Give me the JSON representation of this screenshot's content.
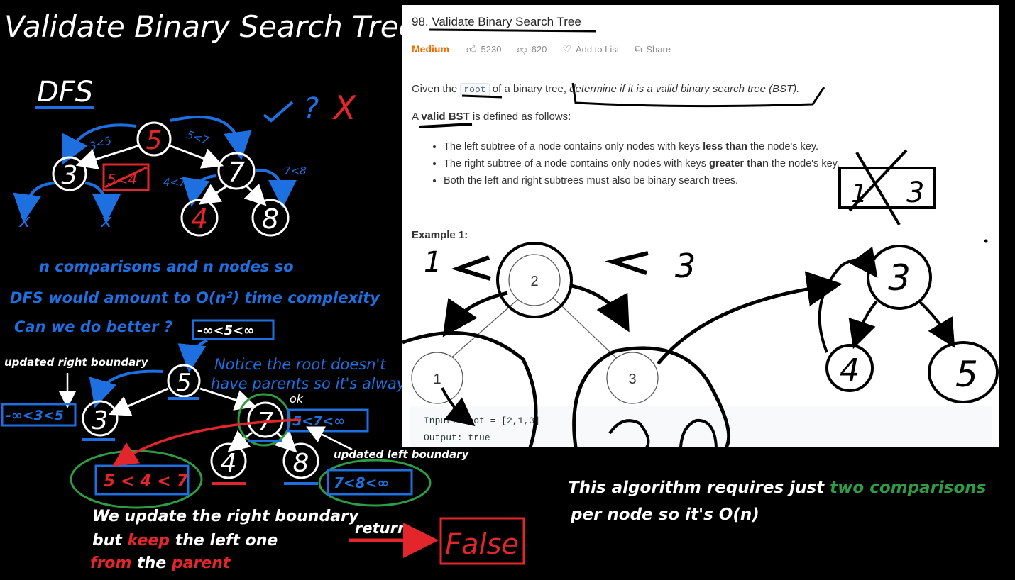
{
  "whiteboard": {
    "title": "Validate Binary Search Tree :",
    "dfs_heading": "DFS",
    "question_mark": "?",
    "cross_mark": "X",
    "tree1": {
      "nodes": [
        "5",
        "3",
        "7",
        "4",
        "8"
      ],
      "labels": [
        "3<5",
        "5<7",
        "4<7",
        "7<8",
        "5<4"
      ],
      "null_marks": [
        "x",
        "x"
      ]
    },
    "note_complexity": [
      "n  comparisons  and   n  nodes  so",
      "DFS  would  amount  to  O(n²)  time  complexity",
      "Can  we  do  better ?"
    ],
    "root_range": "-∞<5<∞",
    "updated_right_label": "updated right boundary",
    "root_note": [
      "Notice the root doesn't",
      "have parents so it's always"
    ],
    "tree2": {
      "nodes": [
        "5",
        "3",
        "7",
        "4",
        "8"
      ],
      "ok_label": "ok",
      "ranges": [
        "-∞<3<5",
        "5<7<∞",
        "5 < 4 < 7",
        "7<8<∞"
      ]
    },
    "updated_left_label": "updated left boundary",
    "bottom_note": {
      "line1": "We update the right boundary",
      "line2_pre": "but ",
      "line2_keep": "keep",
      "line2_post": " the left one",
      "line3_from": "from",
      "line3_the": " the ",
      "line3_parent": "parent"
    },
    "return_label": "return",
    "false_label": "False",
    "right_note": {
      "line1_pre": "This algorithm requires just ",
      "line1_highlight": "two comparisons",
      "line2": "per node so it's O(n)"
    },
    "example_marks": {
      "left_value": "1",
      "right_value": "3",
      "tree_nodes": [
        "3",
        "4",
        "5"
      ],
      "cross_box": [
        "1",
        "3"
      ]
    },
    "colors": {
      "ink": "#ffffff",
      "blue": "#1e6fe0",
      "red": "#e3262b",
      "green": "#2f9b45"
    }
  },
  "problem": {
    "number_prefix": "98. ",
    "title": "Validate Binary Search Tree",
    "difficulty": "Medium",
    "likes": "5230",
    "dislikes": "620",
    "add_to_list": "Add to List",
    "share": "Share",
    "icons": {
      "likes": "thumbs-up-icon",
      "dislikes": "thumbs-down-icon",
      "add_to_list": "heart-icon",
      "share": "share-icon"
    },
    "desc_pre": "Given the ",
    "desc_code": "root",
    "desc_mid": " of a binary tree, ",
    "desc_em": "determine if it is a valid binary search tree (BST).",
    "def_pre": "A ",
    "def_bold": "valid BST",
    "def_post": " is defined as follows:",
    "rules": [
      {
        "pre": "The left subtree of a node contains only nodes with keys ",
        "bold": "less than",
        "post": " the node's key."
      },
      {
        "pre": "The right subtree of a node contains only nodes with keys ",
        "bold": "greater than",
        "post": " the node's key."
      },
      {
        "pre": "Both the left and right subtrees must also be binary search trees.",
        "bold": "",
        "post": ""
      }
    ],
    "example_heading": "Example 1:",
    "example_tree": [
      "2",
      "1",
      "3"
    ],
    "input_label": "Input: ",
    "input_value": "root = [2,1,3]",
    "output_label": "Output: ",
    "output_value": "true"
  }
}
